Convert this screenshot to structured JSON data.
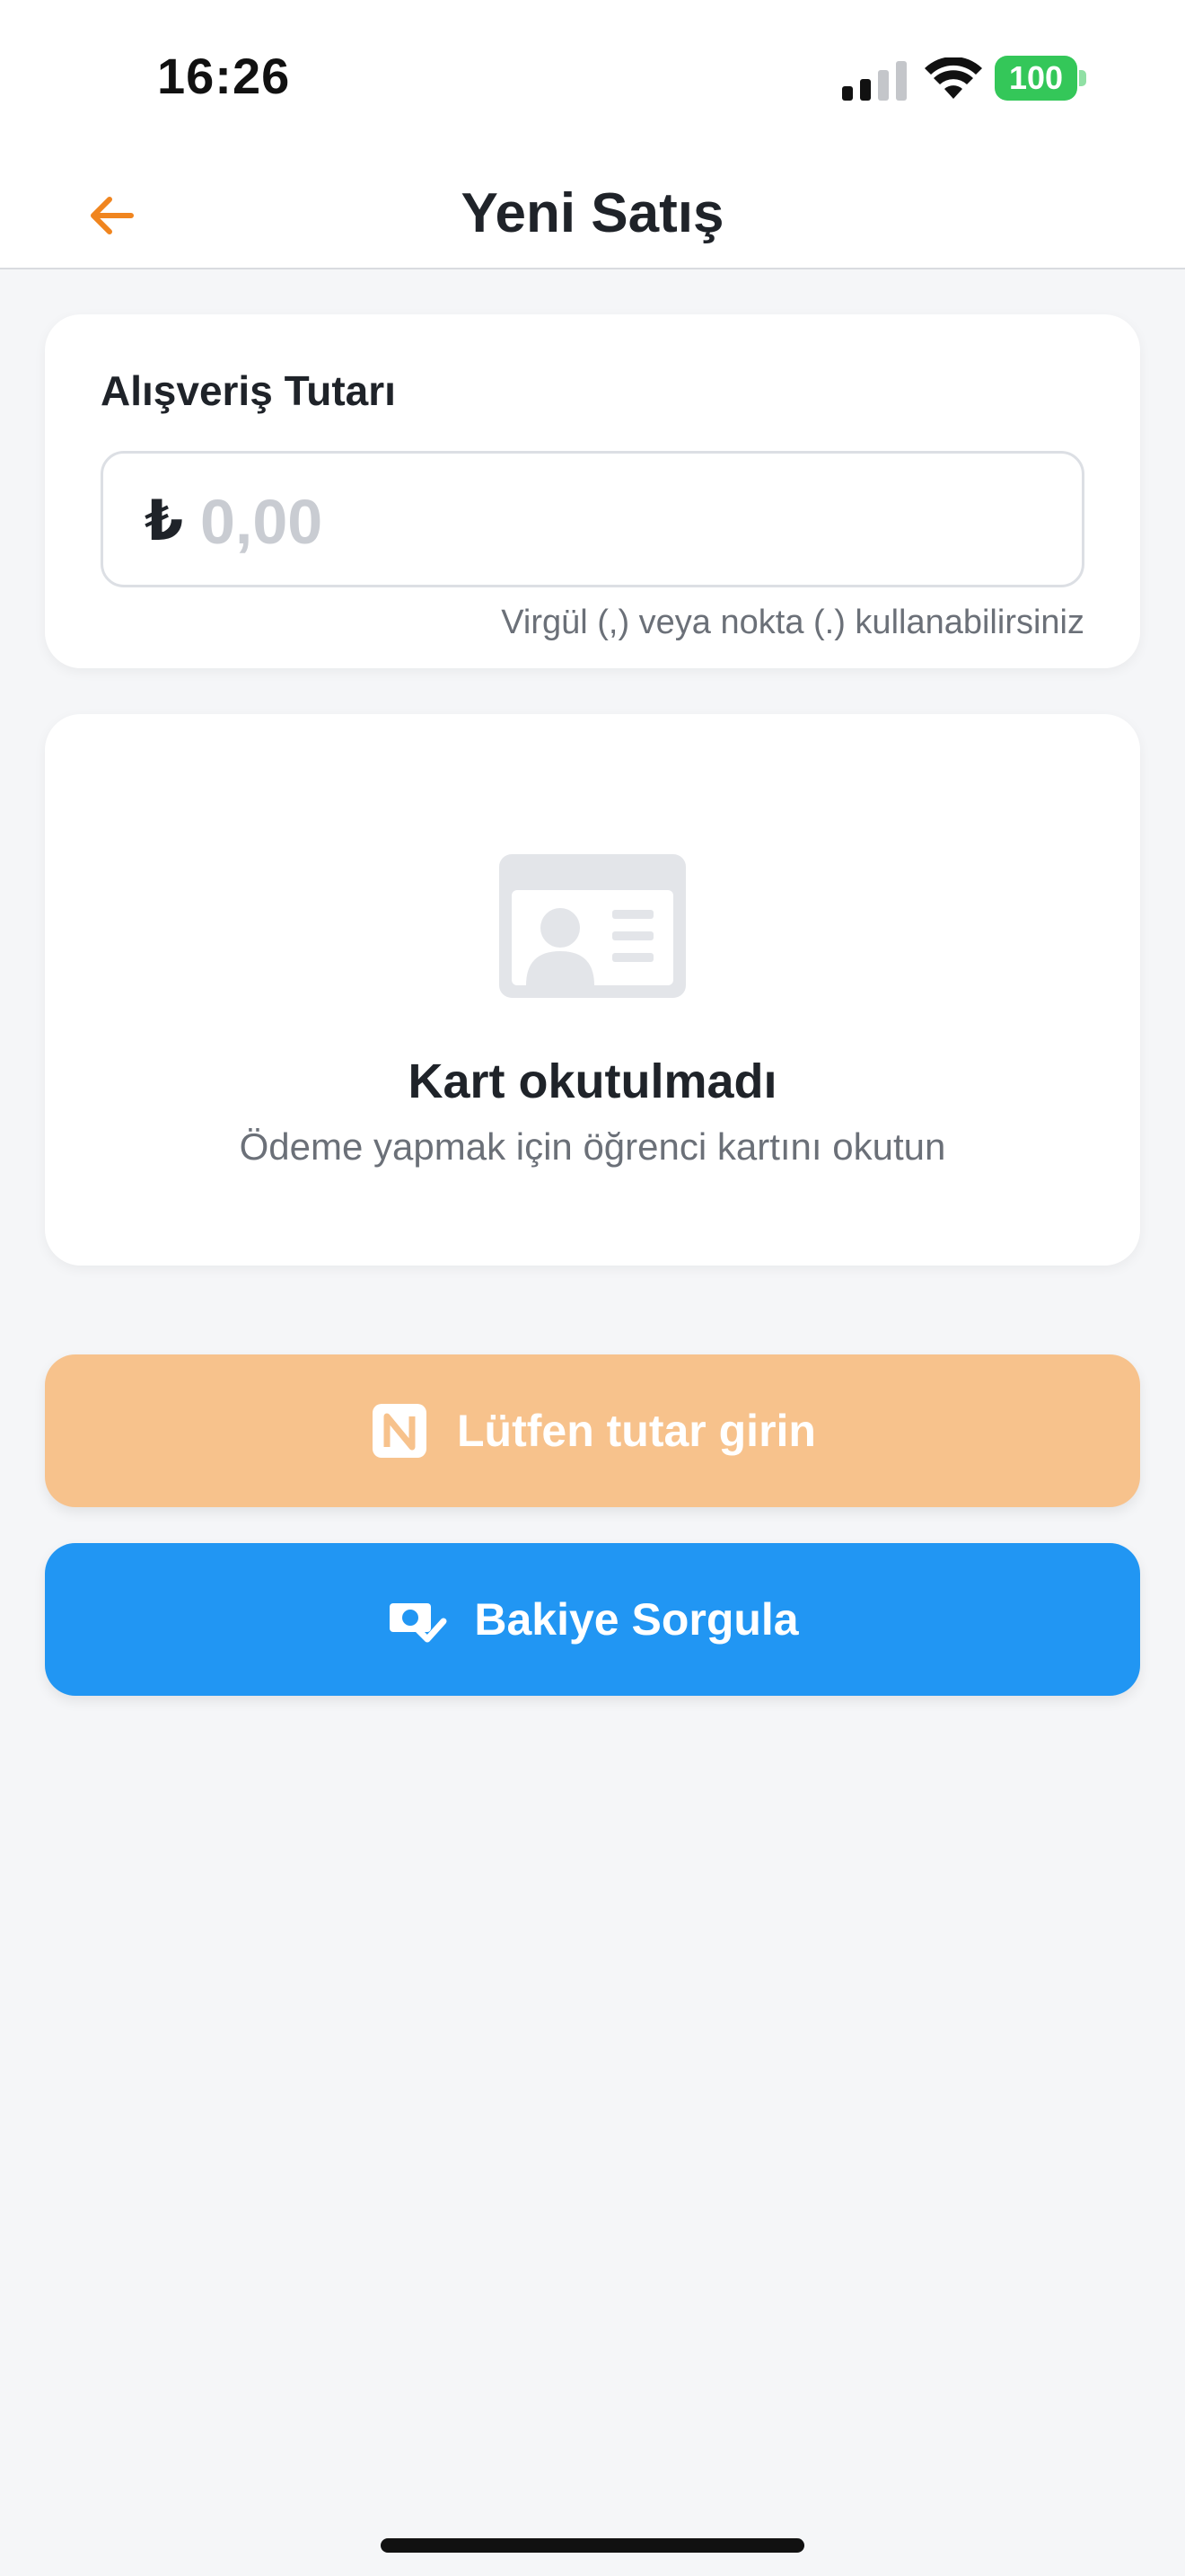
{
  "status_bar": {
    "time": "16:26",
    "battery": "100",
    "icons": [
      "signal-icon",
      "wifi-icon",
      "battery-icon"
    ]
  },
  "header": {
    "title": "Yeni Satış",
    "back_icon": "arrow-left-icon",
    "accent_color": "#f0851f"
  },
  "amount_card": {
    "label": "Alışveriş Tutarı",
    "currency_symbol": "₺",
    "value": "",
    "placeholder": "0,00",
    "hint": "Virgül (,) veya nokta (.) kullanabilirsiniz"
  },
  "card_status": {
    "icon": "id-card-icon",
    "title": "Kart okutulmadı",
    "subtitle": "Ödeme yapmak için öğrenci kartını okutun"
  },
  "buttons": {
    "pay": {
      "label": "Lütfen tutar girin",
      "icon": "nfc-icon",
      "color": "#f7c28c",
      "disabled": true
    },
    "balance": {
      "label": "Bakiye Sorgula",
      "icon": "money-check-icon",
      "color": "#2196f3"
    }
  }
}
